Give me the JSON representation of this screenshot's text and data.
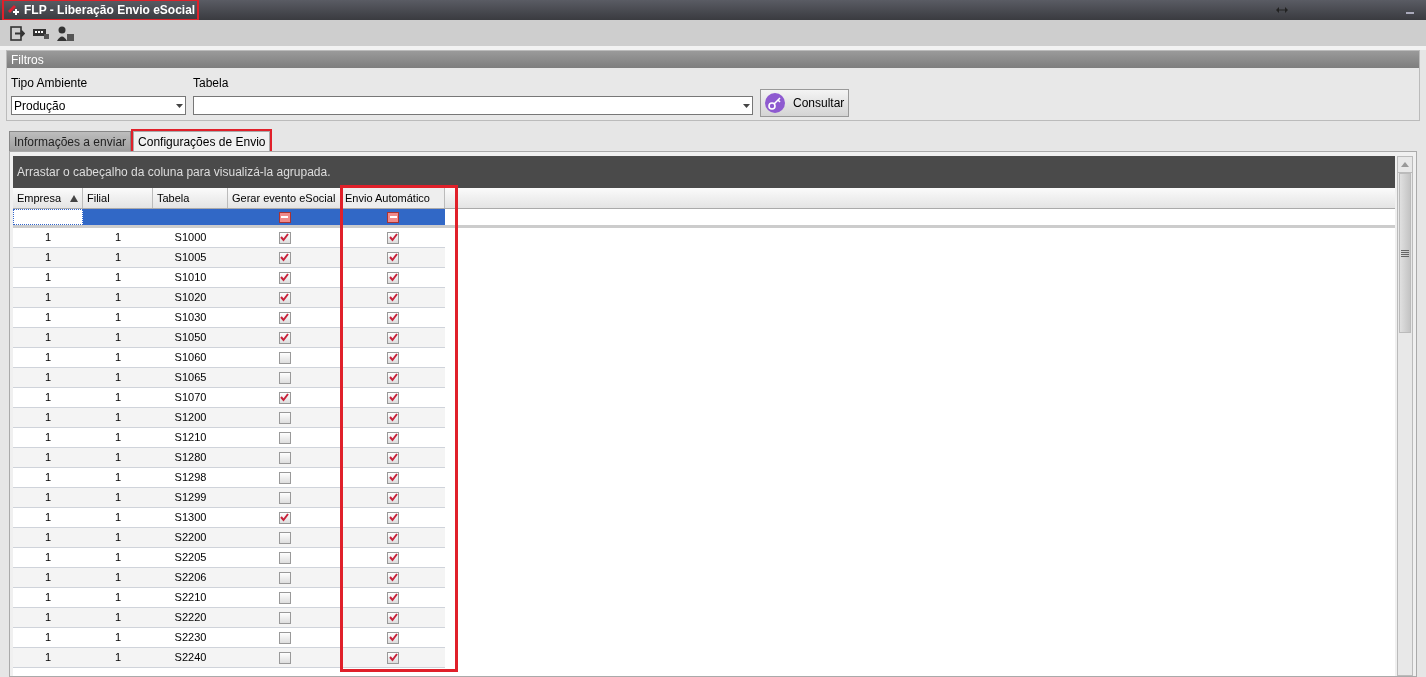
{
  "window": {
    "title": "FLP - Liberação Envio eSocial",
    "highlighted": true
  },
  "filters": {
    "title": "Filtros",
    "fields": [
      {
        "label": "Tipo Ambiente",
        "value": "Produção"
      },
      {
        "label": "Tabela"
      }
    ],
    "button": "Consultar"
  },
  "tabs": [
    {
      "label": "Informações a enviar",
      "selected": false,
      "highlighted": false
    },
    {
      "label": "Configurações de Envio",
      "selected": true,
      "highlighted": true
    }
  ],
  "grid": {
    "group_hint": "Arrastar o cabeçalho da coluna para visualizá-la agrupada.",
    "columns": [
      {
        "label": "Empresa",
        "sorted_ascending": true,
        "highlighted": false
      },
      {
        "label": "Filial",
        "sorted_ascending": false,
        "highlighted": false
      },
      {
        "label": "Tabela",
        "sorted_ascending": false,
        "highlighted": false
      },
      {
        "label": "Gerar evento eSocial",
        "sorted_ascending": false,
        "highlighted": false,
        "filter_indeterminate": true
      },
      {
        "label": "Envio Automático",
        "sorted_ascending": false,
        "highlighted": true,
        "filter_indeterminate": true
      }
    ],
    "rows": [
      {
        "empresa": "1",
        "filial": "1",
        "tabela": "S1000",
        "gerar": true,
        "envio": true
      },
      {
        "empresa": "1",
        "filial": "1",
        "tabela": "S1005",
        "gerar": true,
        "envio": true
      },
      {
        "empresa": "1",
        "filial": "1",
        "tabela": "S1010",
        "gerar": true,
        "envio": true
      },
      {
        "empresa": "1",
        "filial": "1",
        "tabela": "S1020",
        "gerar": true,
        "envio": true
      },
      {
        "empresa": "1",
        "filial": "1",
        "tabela": "S1030",
        "gerar": true,
        "envio": true
      },
      {
        "empresa": "1",
        "filial": "1",
        "tabela": "S1050",
        "gerar": true,
        "envio": true
      },
      {
        "empresa": "1",
        "filial": "1",
        "tabela": "S1060",
        "gerar": false,
        "envio": true
      },
      {
        "empresa": "1",
        "filial": "1",
        "tabela": "S1065",
        "gerar": false,
        "envio": true
      },
      {
        "empresa": "1",
        "filial": "1",
        "tabela": "S1070",
        "gerar": true,
        "envio": true
      },
      {
        "empresa": "1",
        "filial": "1",
        "tabela": "S1200",
        "gerar": false,
        "envio": true
      },
      {
        "empresa": "1",
        "filial": "1",
        "tabela": "S1210",
        "gerar": false,
        "envio": true
      },
      {
        "empresa": "1",
        "filial": "1",
        "tabela": "S1280",
        "gerar": false,
        "envio": true
      },
      {
        "empresa": "1",
        "filial": "1",
        "tabela": "S1298",
        "gerar": false,
        "envio": true
      },
      {
        "empresa": "1",
        "filial": "1",
        "tabela": "S1299",
        "gerar": false,
        "envio": true
      },
      {
        "empresa": "1",
        "filial": "1",
        "tabela": "S1300",
        "gerar": true,
        "envio": true
      },
      {
        "empresa": "1",
        "filial": "1",
        "tabela": "S2200",
        "gerar": false,
        "envio": true
      },
      {
        "empresa": "1",
        "filial": "1",
        "tabela": "S2205",
        "gerar": false,
        "envio": true
      },
      {
        "empresa": "1",
        "filial": "1",
        "tabela": "S2206",
        "gerar": false,
        "envio": true
      },
      {
        "empresa": "1",
        "filial": "1",
        "tabela": "S2210",
        "gerar": false,
        "envio": true
      },
      {
        "empresa": "1",
        "filial": "1",
        "tabela": "S2220",
        "gerar": false,
        "envio": true
      },
      {
        "empresa": "1",
        "filial": "1",
        "tabela": "S2230",
        "gerar": false,
        "envio": true
      },
      {
        "empresa": "1",
        "filial": "1",
        "tabela": "S2240",
        "gerar": false,
        "envio": true
      }
    ]
  }
}
